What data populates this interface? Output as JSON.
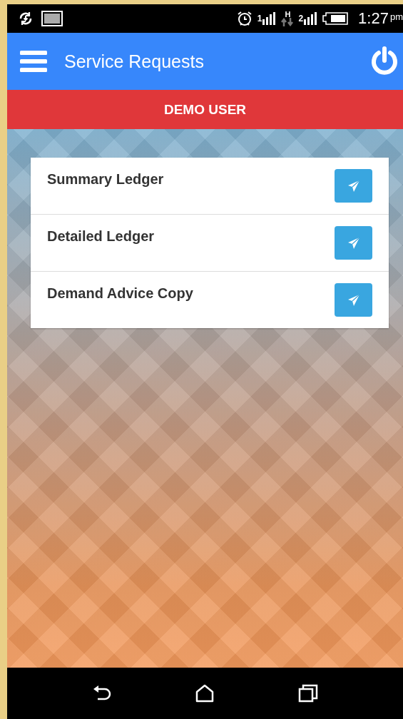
{
  "status_bar": {
    "sim_1": "1",
    "network_type": "H",
    "sim_2": "2",
    "time": "1:27",
    "meridiem": "pm"
  },
  "app_bar": {
    "title": "Service Requests"
  },
  "user_banner": "DEMO USER",
  "requests": [
    {
      "label": "Summary Ledger"
    },
    {
      "label": "Detailed Ledger"
    },
    {
      "label": "Demand Advice Copy"
    }
  ]
}
